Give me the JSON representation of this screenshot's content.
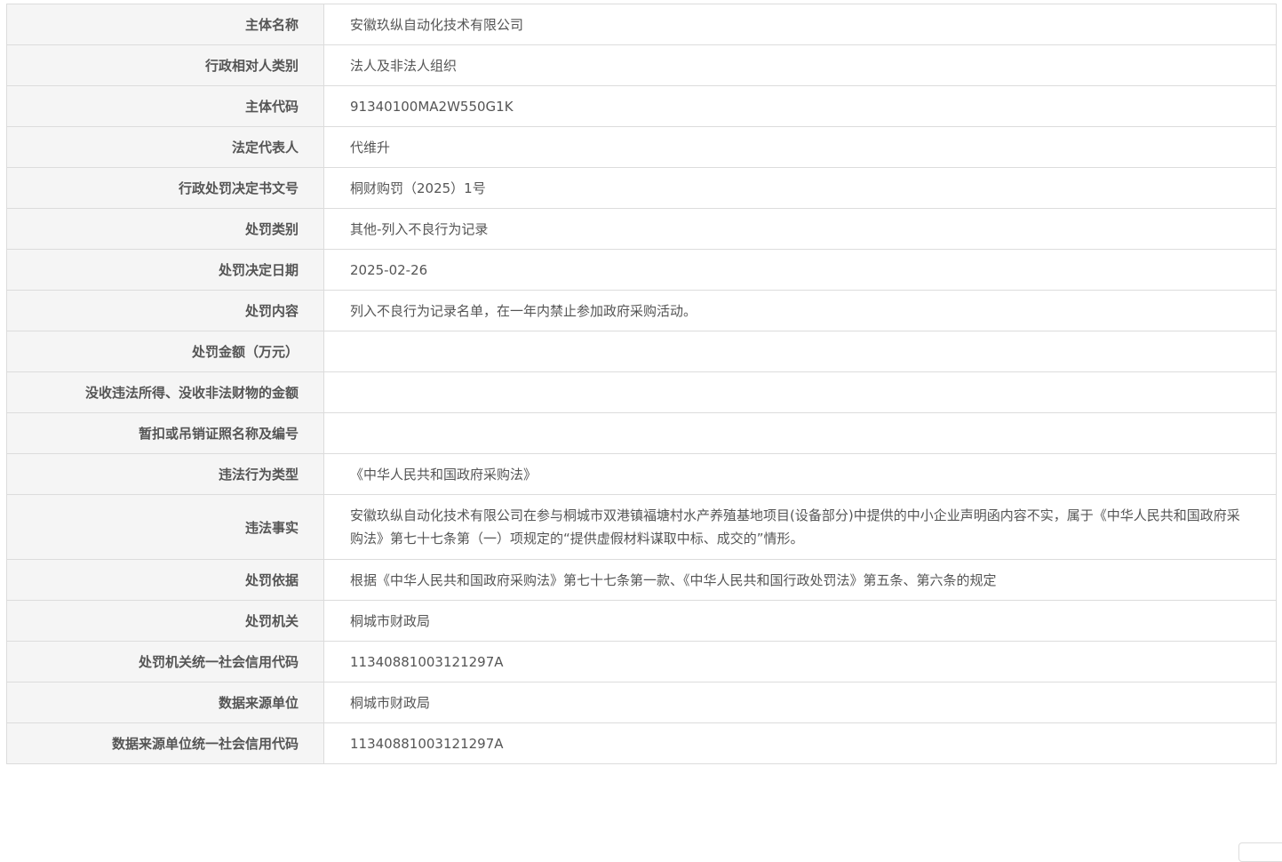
{
  "rows": [
    {
      "label": "主体名称",
      "value": "安徽玖纵自动化技术有限公司"
    },
    {
      "label": "行政相对人类别",
      "value": "法人及非法人组织"
    },
    {
      "label": "主体代码",
      "value": "91340100MA2W550G1K"
    },
    {
      "label": "法定代表人",
      "value": "代维升"
    },
    {
      "label": "行政处罚决定书文号",
      "value": "桐财购罚（2025）1号"
    },
    {
      "label": "处罚类别",
      "value": "其他-列入不良行为记录"
    },
    {
      "label": "处罚决定日期",
      "value": "2025-02-26"
    },
    {
      "label": "处罚内容",
      "value": "列入不良行为记录名单，在一年内禁止参加政府采购活动。"
    },
    {
      "label": "处罚金额（万元）",
      "value": ""
    },
    {
      "label": "没收违法所得、没收非法财物的金额",
      "value": ""
    },
    {
      "label": "暂扣或吊销证照名称及编号",
      "value": ""
    },
    {
      "label": "违法行为类型",
      "value": "《中华人民共和国政府采购法》"
    },
    {
      "label": "违法事实",
      "value": "安徽玖纵自动化技术有限公司在参与桐城市双港镇福塘村水产养殖基地项目(设备部分)中提供的中小企业声明函内容不实，属于《中华人民共和国政府采购法》第七十七条第（一）项规定的“提供虚假材料谋取中标、成交的”情形。"
    },
    {
      "label": "处罚依据",
      "value": "根据《中华人民共和国政府采购法》第七十七条第一款、《中华人民共和国行政处罚法》第五条、第六条的规定"
    },
    {
      "label": "处罚机关",
      "value": "桐城市财政局"
    },
    {
      "label": "处罚机关统一社会信用代码",
      "value": "11340881003121297A"
    },
    {
      "label": "数据来源单位",
      "value": "桐城市财政局"
    },
    {
      "label": "数据来源单位统一社会信用代码",
      "value": "11340881003121297A"
    }
  ]
}
